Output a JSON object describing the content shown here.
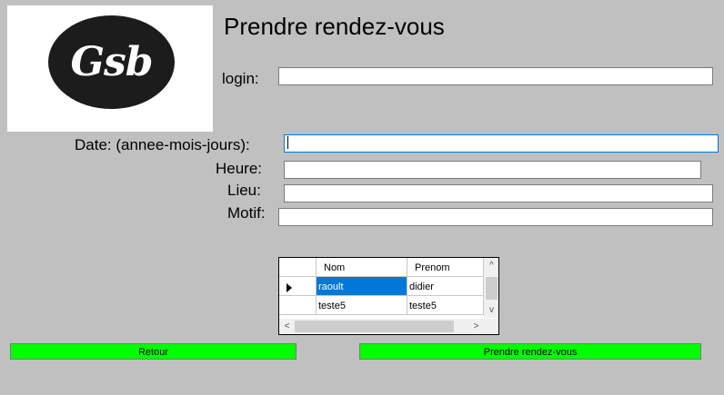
{
  "logo": {
    "text": "Gsb"
  },
  "page": {
    "title": "Prendre rendez-vous"
  },
  "form": {
    "login_label": "login:",
    "login_value": "",
    "date_label": "Date: (annee-mois-jours):",
    "date_value": "",
    "heure_label": "Heure:",
    "heure_value": "",
    "lieu_label": "Lieu:",
    "lieu_value": "",
    "motif_label": "Motif:",
    "motif_value": ""
  },
  "grid": {
    "columns": [
      "Nom",
      "Prenom"
    ],
    "rows": [
      {
        "nom": "raoult",
        "prenom": "didier",
        "selected": true
      },
      {
        "nom": "teste5",
        "prenom": "teste5",
        "selected": false
      }
    ],
    "scroll_up": "^",
    "scroll_down": "v",
    "scroll_left": "<",
    "scroll_right": ">"
  },
  "buttons": {
    "retour": "Retour",
    "prendre": "Prendre rendez-vous"
  },
  "colors": {
    "background": "#c0c0c0",
    "button": "#00ff00",
    "selection": "#0078d7",
    "focus_border": "#0078d7"
  }
}
